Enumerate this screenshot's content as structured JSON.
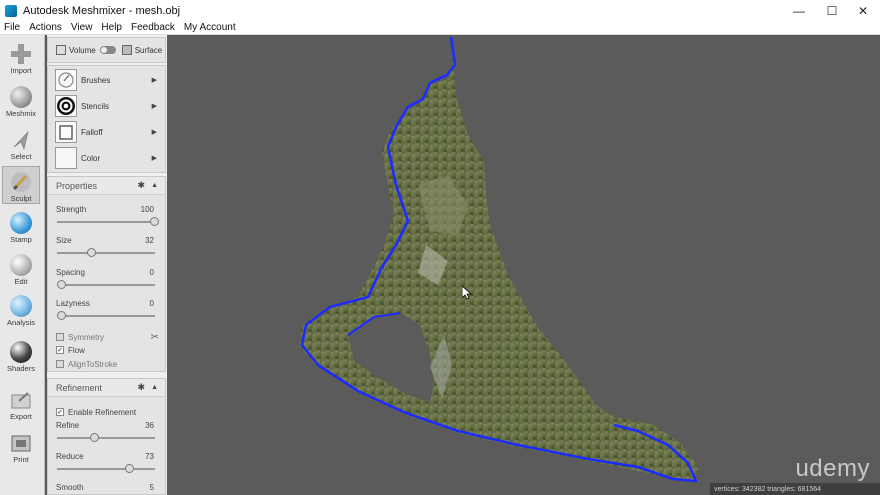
{
  "window": {
    "title": "Autodesk Meshmixer - mesh.obj",
    "controls": {
      "minimize": "—",
      "maximize": "☐",
      "close": "✕"
    }
  },
  "menu": [
    "File",
    "Actions",
    "View",
    "Help",
    "Feedback",
    "My Account"
  ],
  "tools": [
    {
      "label": "Import",
      "icon": "plus-icon"
    },
    {
      "label": "Meshmix",
      "icon": "meshmix-sphere-icon"
    },
    {
      "label": "Select",
      "icon": "select-arrow-icon"
    },
    {
      "label": "Sculpt",
      "icon": "sculpt-brush-icon",
      "active": true
    },
    {
      "label": "Stamp",
      "icon": "stamp-icon"
    },
    {
      "label": "Edit",
      "icon": "edit-sphere-icon"
    },
    {
      "label": "Analysis",
      "icon": "analysis-sphere-icon"
    },
    {
      "label": "Shaders",
      "icon": "shaders-sphere-icon"
    },
    {
      "label": "Export",
      "icon": "export-folder-icon"
    },
    {
      "label": "Print",
      "icon": "print-icon"
    }
  ],
  "mode": {
    "volume": "Volume",
    "surface": "Surface"
  },
  "brush_rows": [
    {
      "label": "Brushes",
      "icon": "brush-thumb-icon"
    },
    {
      "label": "Stencils",
      "icon": "stencil-spiral-icon"
    },
    {
      "label": "Falloff",
      "icon": "falloff-curve-icon"
    },
    {
      "label": "Color",
      "icon": "color-swatch-icon"
    }
  ],
  "properties": {
    "title": "Properties",
    "sliders": [
      {
        "label": "Strength",
        "value": "100",
        "fraction": 1.0
      },
      {
        "label": "Size",
        "value": "32",
        "fraction": 0.32
      },
      {
        "label": "Spacing",
        "value": "0",
        "fraction": 0.0
      },
      {
        "label": "Lazyness",
        "value": "0",
        "fraction": 0.0
      }
    ],
    "checks": [
      {
        "label": "Symmetry",
        "checked": false,
        "dim": true
      },
      {
        "label": "Flow",
        "checked": true,
        "dim": false
      },
      {
        "label": "AlignToStroke",
        "checked": false,
        "dim": true
      }
    ]
  },
  "refinement": {
    "title": "Refinement",
    "enable_label": "Enable Refinement",
    "enable_checked": true,
    "sliders": [
      {
        "label": "Refine",
        "value": "36",
        "fraction": 0.36
      },
      {
        "label": "Reduce",
        "value": "73",
        "fraction": 0.73
      },
      {
        "label": "Smooth",
        "value": "5",
        "fraction": 0.05
      }
    ]
  },
  "viewport": {
    "watermark": "udemy",
    "status": "vertices: 342382 triangles: 681564",
    "outline_color": "#1c2cff"
  },
  "colors": {
    "panel": "#f0f0f0",
    "viewport": "#5b5b5b",
    "accent": "#1c2cff"
  }
}
